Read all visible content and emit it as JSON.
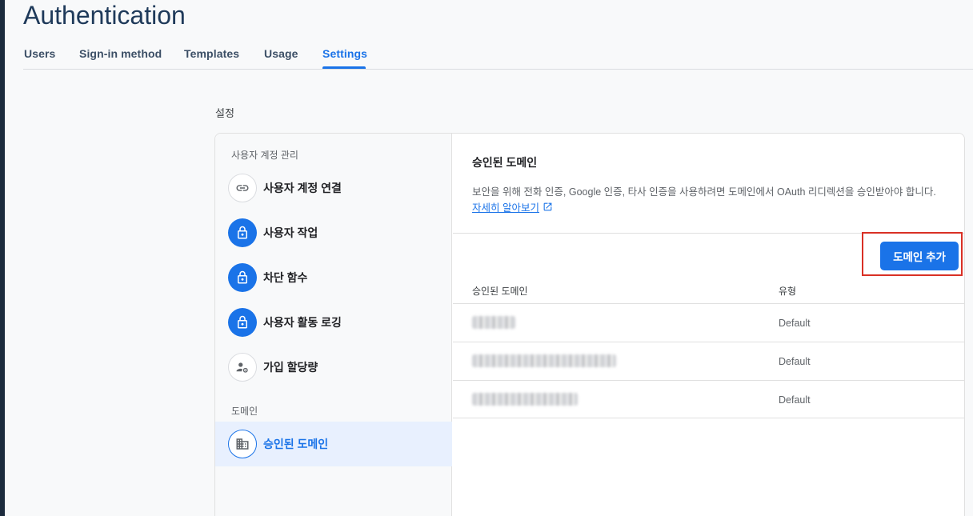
{
  "header": {
    "title": "Authentication",
    "tabs": [
      "Users",
      "Sign-in method",
      "Templates",
      "Usage",
      "Settings"
    ],
    "active_tab": "Settings"
  },
  "settings_label": "설정",
  "sidebar": {
    "group1": "사용자 계정 관리",
    "items": [
      {
        "label": "사용자 계정 연결",
        "icon": "link-icon"
      },
      {
        "label": "사용자 작업",
        "icon": "lock-icon"
      },
      {
        "label": "차단 함수",
        "icon": "lock-icon"
      },
      {
        "label": "사용자 활동 로깅",
        "icon": "lock-icon"
      },
      {
        "label": "가입 할당량",
        "icon": "user-settings-icon"
      }
    ],
    "group2": "도메인",
    "selected_item": {
      "label": "승인된 도메인",
      "icon": "building-icon"
    }
  },
  "main": {
    "title": "승인된 도메인",
    "description": "보안을 위해 전화 인증, Google 인증, 타사 인증을 사용하려면 도메인에서 OAuth 리디렉션을 승인받아야 합니다.",
    "learn_more": "자세히 알아보기",
    "add_button": "도메인 추가",
    "table": {
      "headers": [
        "승인된 도메인",
        "유형"
      ],
      "rows": [
        {
          "type": "Default"
        },
        {
          "type": "Default"
        },
        {
          "type": "Default"
        }
      ]
    }
  },
  "colors": {
    "accent": "#1a73e8",
    "highlight_frame": "#d93025",
    "title": "#1f3a5a"
  }
}
